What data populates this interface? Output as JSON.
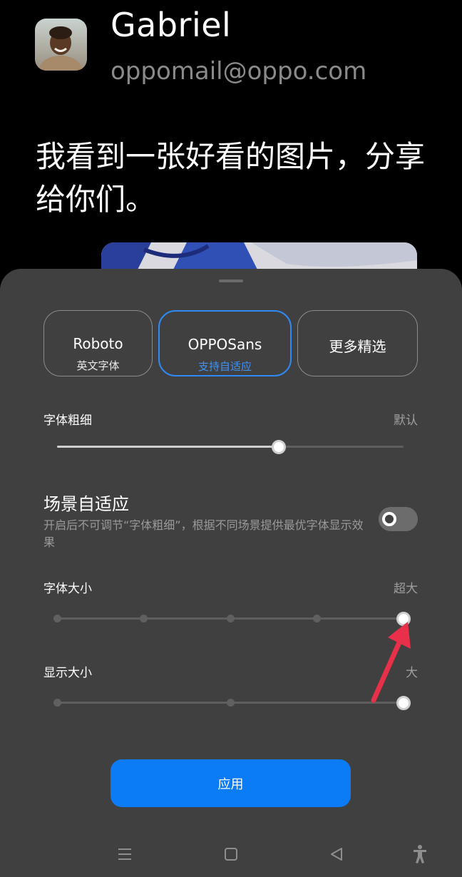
{
  "preview": {
    "user_name": "Gabriel",
    "user_email": "oppomail@oppo.com",
    "message": "我看到一张好看的图片，分享给你们。"
  },
  "font_options": [
    {
      "name": "Roboto",
      "subtitle": "英文字体",
      "selected": false
    },
    {
      "name": "OPPOSans",
      "subtitle": "支持自适应",
      "selected": true
    },
    {
      "name": "更多精选",
      "subtitle": "",
      "selected": false
    }
  ],
  "font_weight": {
    "label": "字体粗细",
    "value": "默认",
    "level": 0.64
  },
  "scene_adaptive": {
    "title": "场景自适应",
    "description": "开启后不可调节“字体粗细”，根据不同场景提供最优字体显示效果",
    "enabled": false
  },
  "font_size": {
    "label": "字体大小",
    "value": "超大",
    "steps": 5,
    "selected_index": 4
  },
  "display_size": {
    "label": "显示大小",
    "value": "大",
    "steps": 3,
    "selected_index": 2
  },
  "apply_label": "应用",
  "nav": {
    "icons": [
      "menu-icon",
      "home-square-icon",
      "back-triangle-icon",
      "accessibility-icon"
    ]
  },
  "colors": {
    "accent": "#0b7cf5",
    "sheet_bg": "#404040",
    "annotation_arrow": "#e8304a"
  }
}
